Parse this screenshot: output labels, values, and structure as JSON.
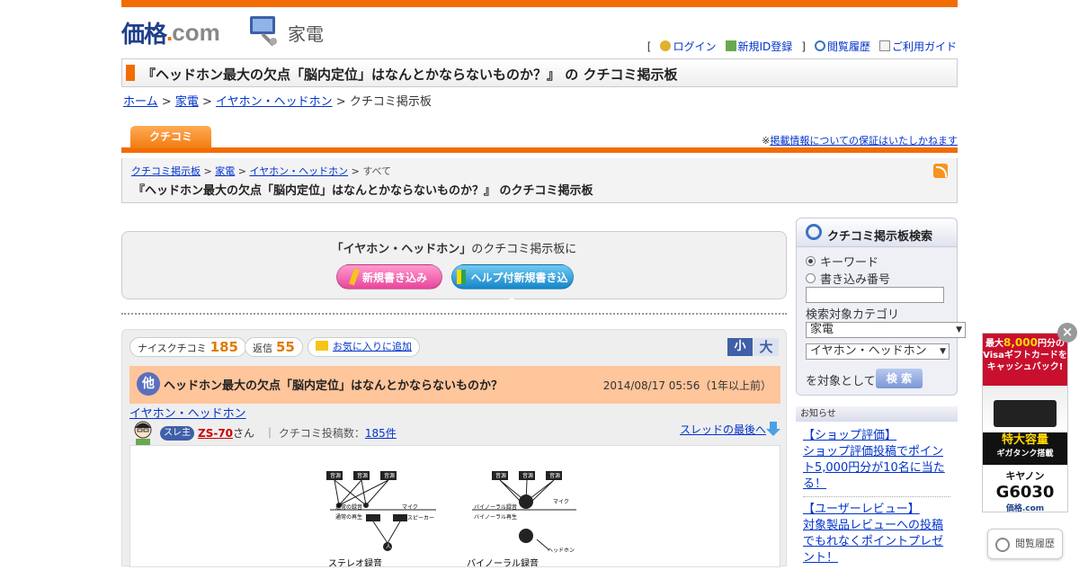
{
  "header": {
    "logo_text": "価格",
    "logo_dot": ".",
    "logo_com": "com",
    "category": "家電"
  },
  "user_menu": {
    "bracket_open": "[",
    "login": "ログイン",
    "register": "新規ID登録",
    "bracket_close": "]",
    "history": "閲覧履歴",
    "guide": "ご利用ガイド"
  },
  "page_title": "『ヘッドホン最大の欠点「脳内定位」はなんとかならないものか？』 の クチコミ掲示板",
  "breadcrumb": {
    "home": "ホーム",
    "sep": ">",
    "kaden": "家電",
    "earphone": "イヤホン・ヘッドホン",
    "current": "クチコミ掲示板"
  },
  "tab": {
    "label": "クチコミ",
    "note_prefix": "※",
    "note_link": "掲載情報についての保証はいたしかねます"
  },
  "sub_crumb": {
    "board": "クチコミ掲示板",
    "kaden": "家電",
    "earphone": "イヤホン・ヘッドホン",
    "all": "すべて",
    "sep": ">"
  },
  "board_heading": "『ヘッドホン最大の欠点「脳内定位」はなんとかならないものか？』 のクチコミ掲示板",
  "post_box": {
    "lead_cat": "「イヤホン・ヘッドホン」",
    "lead_rest": "のクチコミ掲示板に",
    "new_post": "新規書き込み",
    "help_post": "ヘルプ付新規書き込み"
  },
  "thread": {
    "nice_label": "ナイスクチコミ",
    "nice_count": "185",
    "reply_label": "返信",
    "reply_count": "55",
    "favorite": "お気に入りに追加",
    "size_small": "小",
    "size_large": "大",
    "badge": "他",
    "title": "ヘッドホン最大の欠点「脳内定位」はなんとかならないものか？",
    "date": "2014/08/17 05:56（1年以上前）",
    "category_link": "イヤホン・ヘッドホン",
    "owner_badge": "スレ主",
    "user": "ZS-70",
    "san": "さん",
    "post_count_label": "クチコミ投稿数：",
    "post_count": "185件",
    "to_last": "スレッドの最後へ",
    "diagram": {
      "left_labels": [
        "音源",
        "音源",
        "音源",
        "通常の録音",
        "通常の再生",
        "マイク",
        "スピーカー",
        "人"
      ],
      "right_labels": [
        "音源",
        "音源",
        "音源",
        "バイノーラル録音",
        "バイノーラル再生",
        "マイク",
        "ヘッドホン"
      ],
      "caption_left": "ステレオ録音",
      "caption_right": "バイノーラル録音"
    }
  },
  "search": {
    "title": "クチコミ掲示板検索",
    "radio_keyword": "キーワード",
    "radio_number": "書き込み番号",
    "input_value": "",
    "category_label": "検索対象カテゴリ",
    "select1": "家電",
    "select2": "イヤホン・ヘッドホン",
    "target_text": "を対象として",
    "button": "検 索"
  },
  "news": {
    "header": "お知らせ",
    "item1_title": "【ショップ評価】",
    "item1_body": "ショップ評価投稿でポイント5,000円分が10名に当たる！",
    "item2_title": "【ユーザーレビュー】",
    "item2_body": "対象製品レビューへの投稿でもれなくポイントプレゼント！"
  },
  "ad": {
    "line1": "最大",
    "amount": "8,000",
    "line1b": "円分の",
    "line2": "Visaギフトカードを",
    "line3": "キャッシュバック!",
    "mid1": "特大容量",
    "mid2": "ギガタンク搭載",
    "brand": "キヤノン",
    "model": "G6030",
    "logo": "価格.com"
  },
  "close_label": "×",
  "history_button": "閲覧履歴",
  "colors": {
    "accent": "#f26c00",
    "link": "#0033cc",
    "thread_head": "#ffc59b"
  }
}
